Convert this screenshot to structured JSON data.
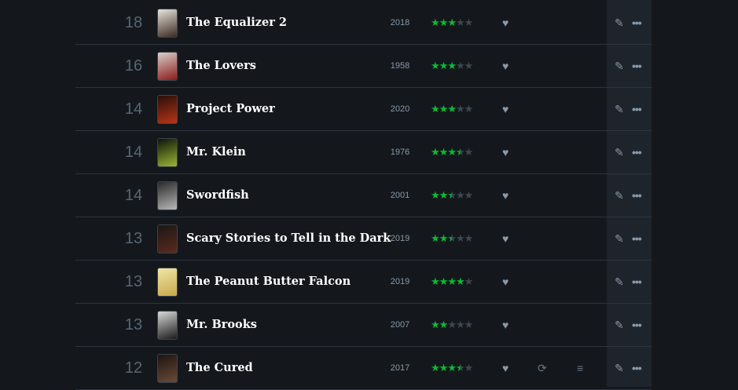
{
  "diary": {
    "entries": [
      {
        "day": "18",
        "title": "The Equalizer 2",
        "year": "2018",
        "stars": 3,
        "half": false,
        "liked": true,
        "rewatch": false,
        "review": false,
        "poster_colors": [
          "#e8e4dc",
          "#3a2a22"
        ]
      },
      {
        "day": "16",
        "title": "The Lovers",
        "year": "1958",
        "stars": 3,
        "half": false,
        "liked": true,
        "rewatch": false,
        "review": false,
        "poster_colors": [
          "#d8d0c8",
          "#8a1a1a"
        ]
      },
      {
        "day": "14",
        "title": "Project Power",
        "year": "2020",
        "stars": 3,
        "half": false,
        "liked": true,
        "rewatch": false,
        "review": false,
        "poster_colors": [
          "#2a0e08",
          "#b8361a"
        ]
      },
      {
        "day": "14",
        "title": "Mr. Klein",
        "year": "1976",
        "stars": 3,
        "half": true,
        "liked": true,
        "rewatch": false,
        "review": false,
        "poster_colors": [
          "#0c140a",
          "#9ab832"
        ]
      },
      {
        "day": "14",
        "title": "Swordfish",
        "year": "2001",
        "stars": 2,
        "half": true,
        "liked": true,
        "rewatch": false,
        "review": false,
        "poster_colors": [
          "#2a2a2a",
          "#b8b8b8"
        ]
      },
      {
        "day": "13",
        "title": "Scary Stories to Tell in the Dark",
        "year": "2019",
        "stars": 2,
        "half": true,
        "liked": true,
        "rewatch": false,
        "review": false,
        "poster_colors": [
          "#1a1814",
          "#5a2a1e"
        ]
      },
      {
        "day": "13",
        "title": "The Peanut Butter Falcon",
        "year": "2019",
        "stars": 4,
        "half": false,
        "liked": true,
        "rewatch": false,
        "review": false,
        "poster_colors": [
          "#f0e6a8",
          "#c8a84a"
        ]
      },
      {
        "day": "13",
        "title": "Mr. Brooks",
        "year": "2007",
        "stars": 2,
        "half": false,
        "liked": true,
        "rewatch": false,
        "review": false,
        "poster_colors": [
          "#d8d8d8",
          "#1a1a1a"
        ]
      },
      {
        "day": "12",
        "title": "The Cured",
        "year": "2017",
        "stars": 3,
        "half": true,
        "liked": true,
        "rewatch": true,
        "review": true,
        "poster_colors": [
          "#1e1410",
          "#6a4a38"
        ]
      }
    ]
  },
  "icons": {
    "star": "★",
    "half_star": "½",
    "heart": "♥",
    "rewatch": "⟳",
    "review": "≡",
    "edit": "✎",
    "more": "•••"
  },
  "colors": {
    "star_green": "#00c030",
    "background": "#14181c",
    "actions_column": "#1d242b"
  }
}
